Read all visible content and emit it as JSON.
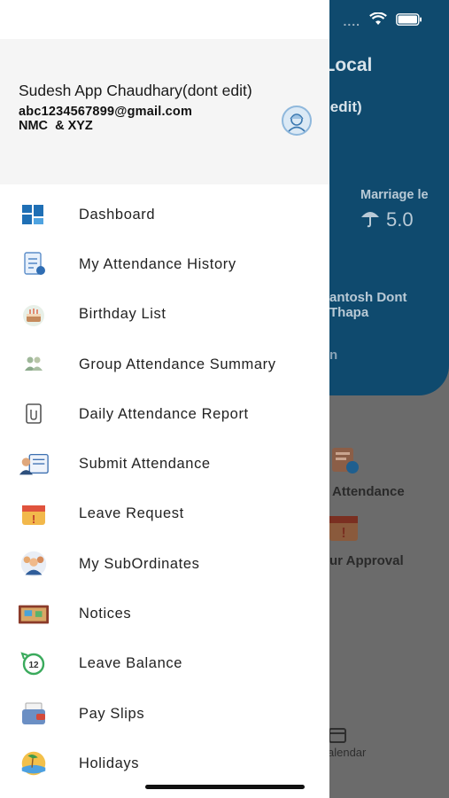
{
  "status_bar": {
    "signal": "....",
    "wifi_icon": "wifi-icon",
    "battery_icon": "battery-icon"
  },
  "background": {
    "title": "e Local",
    "subtitle": "nt edit)",
    "stat_label": "Marriage le",
    "stat_value": "5.0",
    "person_line1": "antosh Dont",
    "person_line2": "Thapa",
    "fragment": "n",
    "card1": "Attendance",
    "card2": "ur Approval",
    "nav_calendar": "alendar"
  },
  "profile": {
    "name": "Sudesh App Chaudhary(dont edit)",
    "email": "abc1234567899@gmail.com",
    "org": "NMC  & XYZ"
  },
  "menu": {
    "items": [
      {
        "label": "Dashboard",
        "icon": "dashboard-icon"
      },
      {
        "label": "My Attendance History",
        "icon": "attendance-history-icon"
      },
      {
        "label": "Birthday List",
        "icon": "birthday-cake-icon"
      },
      {
        "label": "Group Attendance Summary",
        "icon": "group-users-icon"
      },
      {
        "label": "Daily Attendance Report",
        "icon": "report-document-icon"
      },
      {
        "label": "Submit Attendance",
        "icon": "submit-attendance-icon"
      },
      {
        "label": "Leave Request",
        "icon": "leave-calendar-icon"
      },
      {
        "label": "My SubOrdinates",
        "icon": "subordinates-icon"
      },
      {
        "label": "Notices",
        "icon": "notice-board-icon"
      },
      {
        "label": "Leave Balance",
        "icon": "leave-balance-icon"
      },
      {
        "label": "Pay Slips",
        "icon": "wallet-icon"
      },
      {
        "label": "Holidays",
        "icon": "holiday-beach-icon"
      }
    ]
  },
  "colors": {
    "primary": "#0f4a6e",
    "drawer_bg": "#ffffff",
    "profile_bg": "#f5f5f5"
  }
}
